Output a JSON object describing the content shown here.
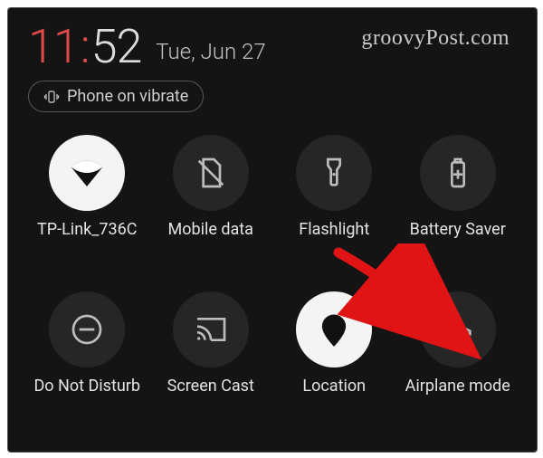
{
  "watermark": "groovyPost.com",
  "clock": {
    "hours": "11",
    "sep": ":",
    "minutes": "52"
  },
  "date": "Tue, Jun 27",
  "vibrate_label": "Phone on vibrate",
  "tiles": {
    "wifi": {
      "label": "TP-Link_736C",
      "active": true
    },
    "mobile_data": {
      "label": "Mobile data",
      "active": false
    },
    "flashlight": {
      "label": "Flashlight",
      "active": false
    },
    "battery": {
      "label": "Battery Saver",
      "active": false
    },
    "dnd": {
      "label": "Do Not Disturb",
      "active": false
    },
    "cast": {
      "label": "Screen Cast",
      "active": false
    },
    "location": {
      "label": "Location",
      "active": true
    },
    "airplane": {
      "label": "Airplane mode",
      "active": false
    }
  },
  "annotation": {
    "type": "arrow",
    "points_to": "airplane",
    "color": "#e01414"
  }
}
